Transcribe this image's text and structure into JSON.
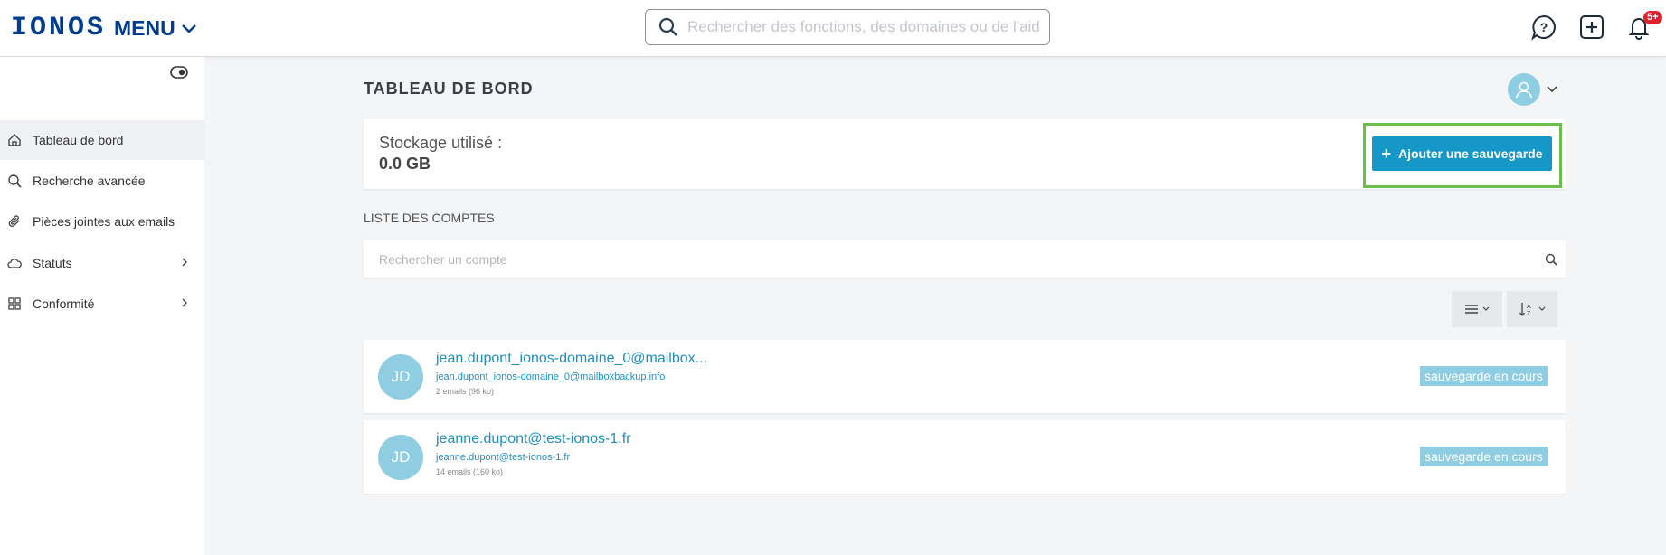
{
  "header": {
    "logo": "IONOS",
    "menu_label": "MENU",
    "search_placeholder": "Rechercher des fonctions, des domaines ou de l'aide",
    "notification_badge": "5+",
    "icons": [
      "help-chat-icon",
      "add-square-icon",
      "bell-icon"
    ]
  },
  "sidebar": {
    "items": [
      {
        "label": "Tableau de bord",
        "icon": "home-icon",
        "active": true
      },
      {
        "label": "Recherche avancée",
        "icon": "search-icon"
      },
      {
        "label": "Pièces jointes aux emails",
        "icon": "paperclip-icon"
      },
      {
        "label": "Statuts",
        "icon": "cloud-icon",
        "expandable": true
      },
      {
        "label": "Conformité",
        "icon": "grid-icon",
        "expandable": true
      }
    ]
  },
  "main": {
    "title": "TABLEAU DE BORD",
    "storage": {
      "label": "Stockage utilisé :",
      "value": "0.0 GB"
    },
    "add_backup_label": "Ajouter une sauvegarde",
    "accounts_section_label": "LISTE DES COMPTES",
    "account_search_placeholder": "Rechercher un compte",
    "accounts": [
      {
        "initials": "JD",
        "title": "jean.dupont_ionos-domaine_0@mailbox...",
        "email": "jean.dupont_ionos-domaine_0@mailboxbackup.info",
        "meta": "2 emails (96 ko)",
        "status": "sauvegarde en cours"
      },
      {
        "initials": "JD",
        "title": "jeanne.dupont@test-ionos-1.fr",
        "email": "jeanne.dupont@test-ionos-1.fr",
        "meta": "14 emails (160 ko)",
        "status": "sauvegarde en cours"
      }
    ]
  },
  "colors": {
    "brand": "#003d8f",
    "accent": "#1597c8",
    "avatar": "#8fcde3",
    "highlight": "#6abf4b",
    "badge": "#e3212e"
  }
}
